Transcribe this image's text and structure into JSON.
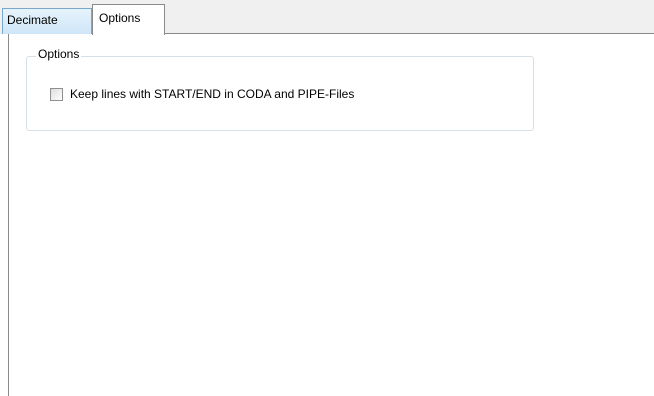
{
  "tabs": [
    {
      "label": "Decimate",
      "selected": false
    },
    {
      "label": "Options",
      "selected": true
    }
  ],
  "options_group": {
    "title": "Options",
    "keep_lines_checkbox": {
      "label": "Keep lines with START/END in CODA and PIPE-Files",
      "checked": false
    }
  }
}
